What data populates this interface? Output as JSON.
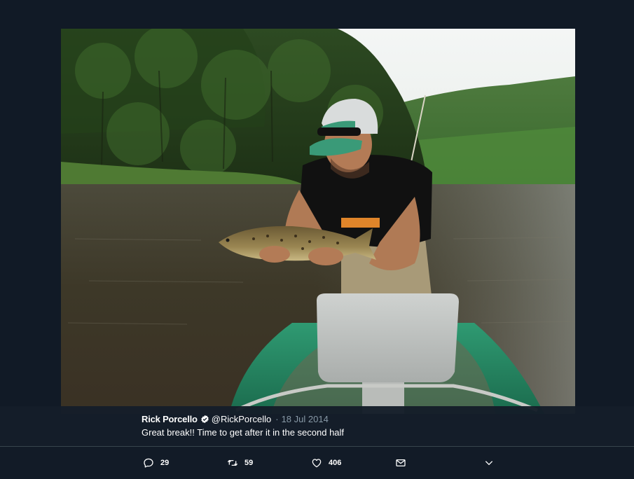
{
  "photo": {
    "description_icon": "photo-fisherman-trout"
  },
  "tweet": {
    "author_name": "Rick Porcello",
    "handle": "@RickPorcello",
    "separator": "·",
    "date": "18 Jul 2014",
    "text": "Great break!! Time to get after it in the second half",
    "verified_icon": "verified-badge-icon"
  },
  "actions": {
    "reply_count": "29",
    "retweet_count": "59",
    "like_count": "406"
  },
  "colors": {
    "background": "#111a26",
    "text": "#ffffff",
    "muted": "#8899a6"
  }
}
